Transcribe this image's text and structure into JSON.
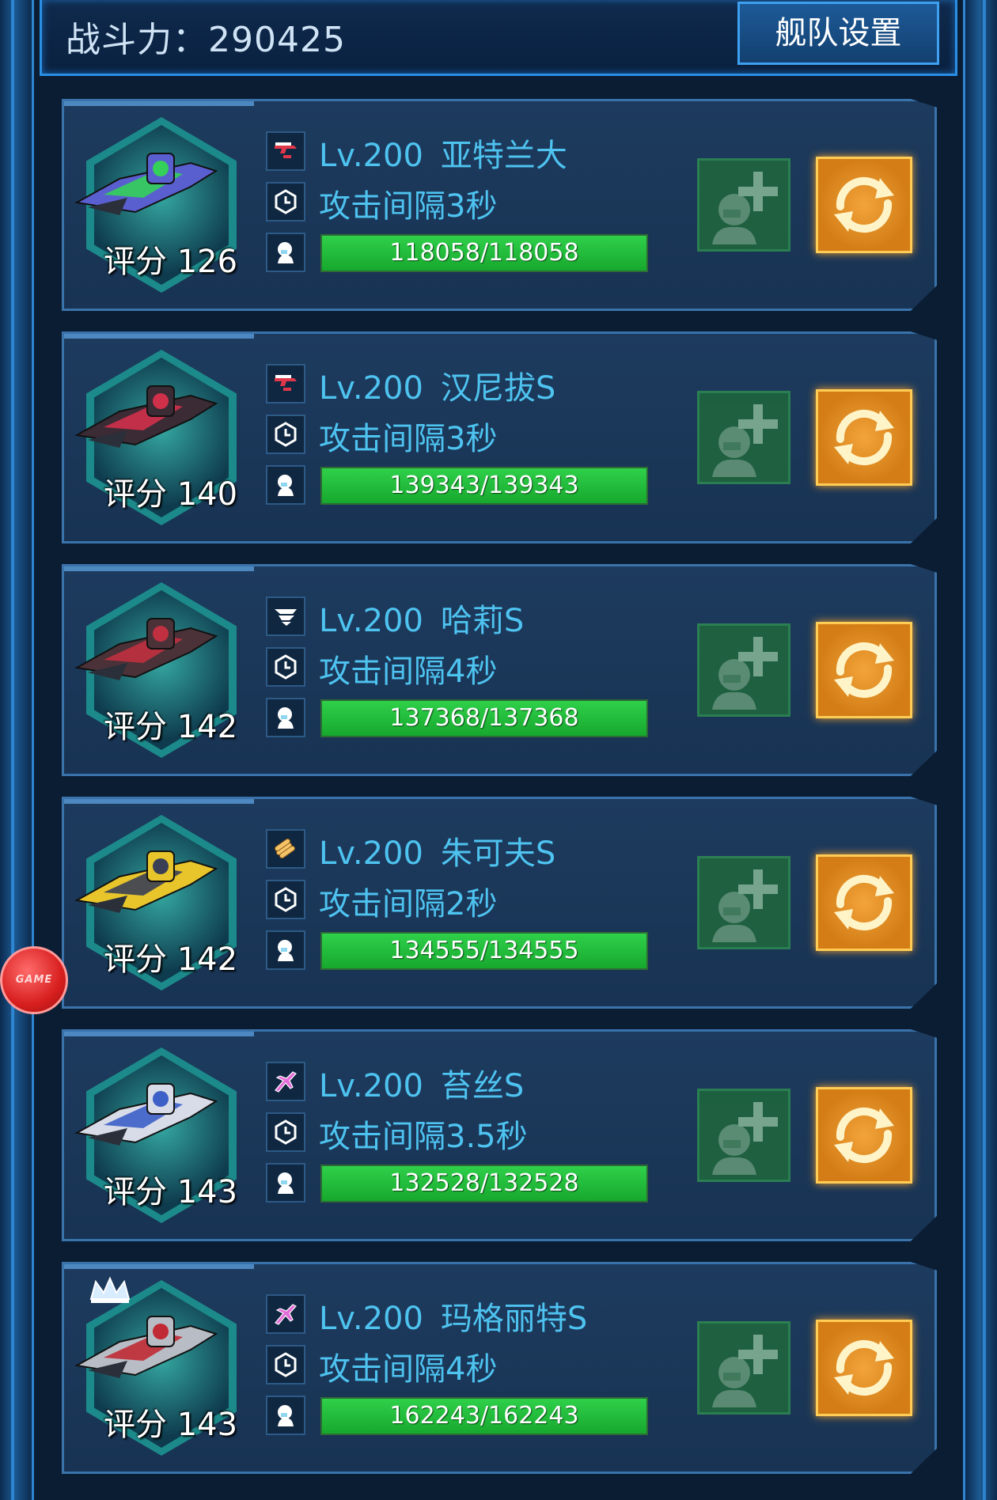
{
  "header": {
    "power_label": "战斗力：290425",
    "fleet_settings_label": "舰队设置"
  },
  "ships": [
    {
      "level": "Lv.200",
      "name": "亚特兰大",
      "interval": "攻击间隔3秒",
      "hp": "118058/118058",
      "hp_fraction": 1.0,
      "score": "评分 126",
      "class_icon": "cannon-icon",
      "hull_color": "#5a5fd0",
      "accent": "#34d05a",
      "crown": false
    },
    {
      "level": "Lv.200",
      "name": "汉尼拔S",
      "interval": "攻击间隔3秒",
      "hp": "139343/139343",
      "hp_fraction": 1.0,
      "score": "评分 140",
      "class_icon": "cannon-icon",
      "hull_color": "#3a2b35",
      "accent": "#d0304a",
      "crown": false
    },
    {
      "level": "Lv.200",
      "name": "哈莉S",
      "interval": "攻击间隔4秒",
      "hp": "137368/137368",
      "hp_fraction": 1.0,
      "score": "评分 142",
      "class_icon": "wing-icon",
      "hull_color": "#4a3238",
      "accent": "#c03040",
      "crown": false
    },
    {
      "level": "Lv.200",
      "name": "朱可夫S",
      "interval": "攻击间隔2秒",
      "hp": "134555/134555",
      "hp_fraction": 1.0,
      "score": "评分 142",
      "class_icon": "missile-icon",
      "hull_color": "#e8c52a",
      "accent": "#3a3f55",
      "crown": false
    },
    {
      "level": "Lv.200",
      "name": "苔丝S",
      "interval": "攻击间隔3.5秒",
      "hp": "132528/132528",
      "hp_fraction": 1.0,
      "score": "评分 143",
      "class_icon": "fighter-icon",
      "hull_color": "#d8dce8",
      "accent": "#3d5fc8",
      "crown": false
    },
    {
      "level": "Lv.200",
      "name": "玛格丽特S",
      "interval": "攻击间隔4秒",
      "hp": "162243/162243",
      "hp_fraction": 1.0,
      "score": "评分 143",
      "class_icon": "fighter-icon",
      "hull_color": "#b8bcc4",
      "accent": "#c02a35",
      "crown": true
    }
  ],
  "floating_badge": "GAME",
  "colors": {
    "text_cyan": "#4ec3f0",
    "hp_green": "#22c23d",
    "swap_orange": "#e8921f",
    "add_green": "#1f6b3a"
  }
}
